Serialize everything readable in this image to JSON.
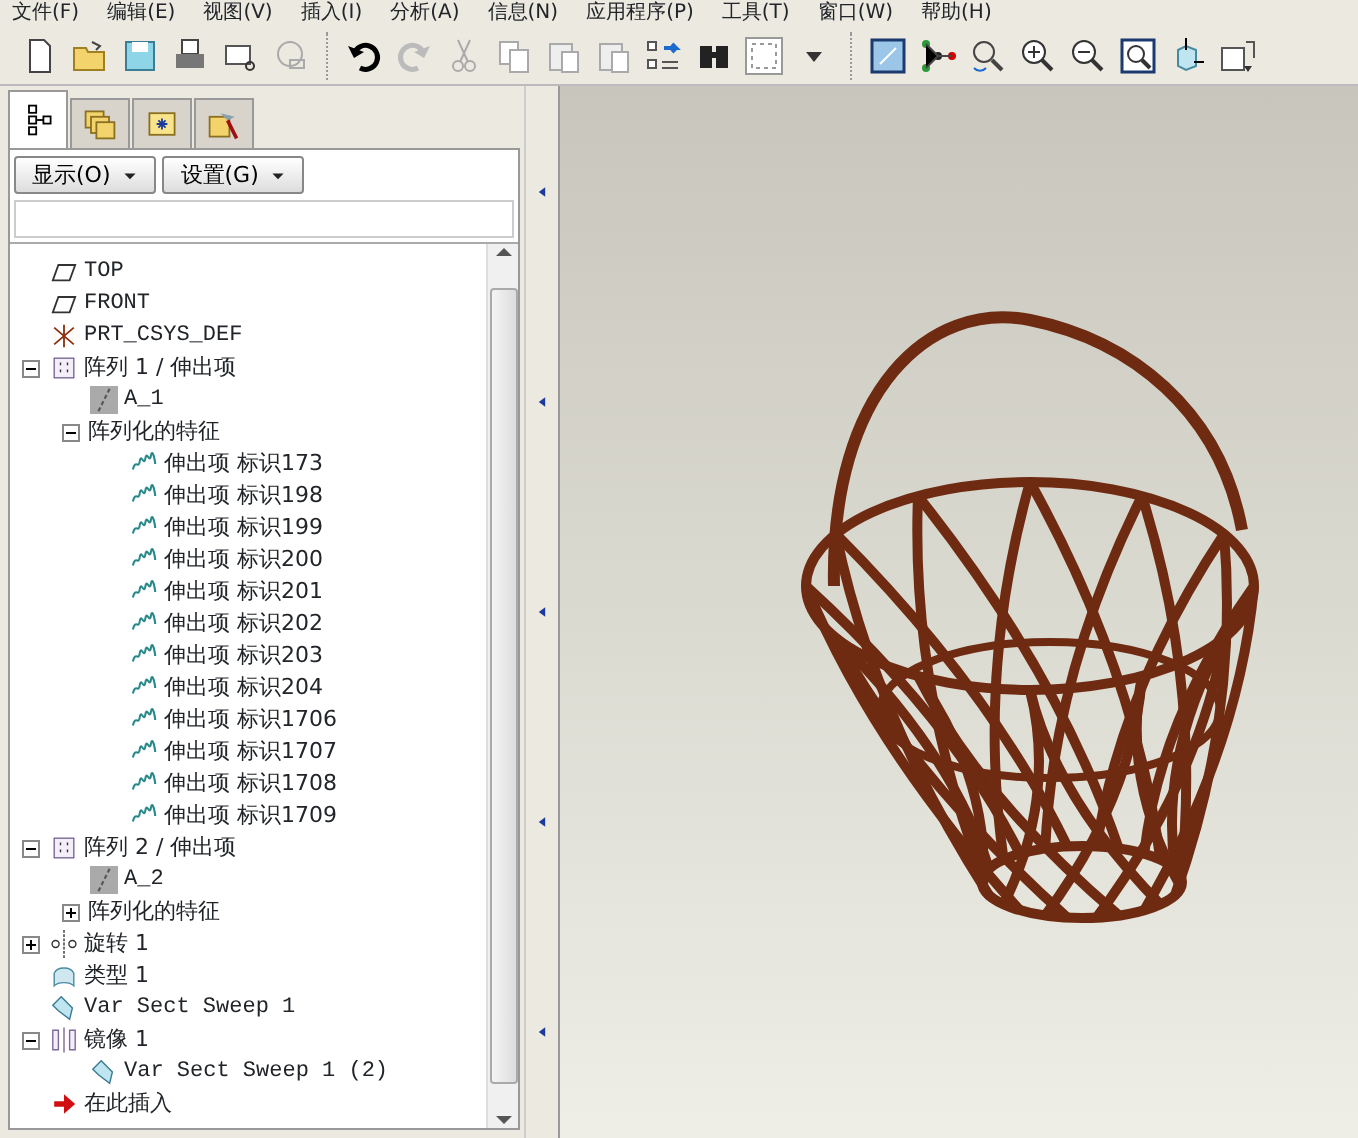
{
  "menu": [
    "文件(F)",
    "编辑(E)",
    "视图(V)",
    "插入(I)",
    "分析(A)",
    "信息(N)",
    "应用程序(P)",
    "工具(T)",
    "窗口(W)",
    "帮助(H)"
  ],
  "navigator_tabs": [
    {
      "selected": true
    },
    {
      "selected": false
    },
    {
      "selected": false
    },
    {
      "selected": false
    }
  ],
  "nav_buttons": [
    "显示(O)",
    "设置(G)"
  ],
  "model_tree": [
    {
      "label": "TOP",
      "kind": "plane"
    },
    {
      "label": "FRONT",
      "kind": "plane"
    },
    {
      "label": "PRT_CSYS_DEF",
      "kind": "csys"
    },
    {
      "label": "阵列 1 / 伸出项",
      "kind": "pattern",
      "expanded": true,
      "children": [
        {
          "label": "A_1",
          "kind": "axis"
        },
        {
          "label": "阵列化的特征",
          "kind": "group",
          "expanded": true,
          "children": [
            {
              "label": "伸出项 标识173",
              "kind": "protrusion"
            },
            {
              "label": "伸出项 标识198",
              "kind": "protrusion"
            },
            {
              "label": "伸出项 标识199",
              "kind": "protrusion"
            },
            {
              "label": "伸出项 标识200",
              "kind": "protrusion"
            },
            {
              "label": "伸出项 标识201",
              "kind": "protrusion"
            },
            {
              "label": "伸出项 标识202",
              "kind": "protrusion"
            },
            {
              "label": "伸出项 标识203",
              "kind": "protrusion"
            },
            {
              "label": "伸出项 标识204",
              "kind": "protrusion"
            },
            {
              "label": "伸出项 标识1706",
              "kind": "protrusion"
            },
            {
              "label": "伸出项 标识1707",
              "kind": "protrusion"
            },
            {
              "label": "伸出项 标识1708",
              "kind": "protrusion"
            },
            {
              "label": "伸出项 标识1709",
              "kind": "protrusion"
            }
          ]
        }
      ]
    },
    {
      "label": "阵列 2 / 伸出项",
      "kind": "pattern",
      "expanded": true,
      "children": [
        {
          "label": "A_2",
          "kind": "axis"
        },
        {
          "label": "阵列化的特征",
          "kind": "group",
          "expanded": false
        }
      ]
    },
    {
      "label": "旋转 1",
      "kind": "revolve",
      "expanded": false
    },
    {
      "label": "类型 1",
      "kind": "type"
    },
    {
      "label": "Var Sect Sweep 1",
      "kind": "sweep"
    },
    {
      "label": "镜像 1",
      "kind": "mirror",
      "expanded": true,
      "children": [
        {
          "label": "Var Sect Sweep 1 (2)",
          "kind": "sweep"
        }
      ]
    },
    {
      "label": "在此插入",
      "kind": "insert"
    }
  ]
}
